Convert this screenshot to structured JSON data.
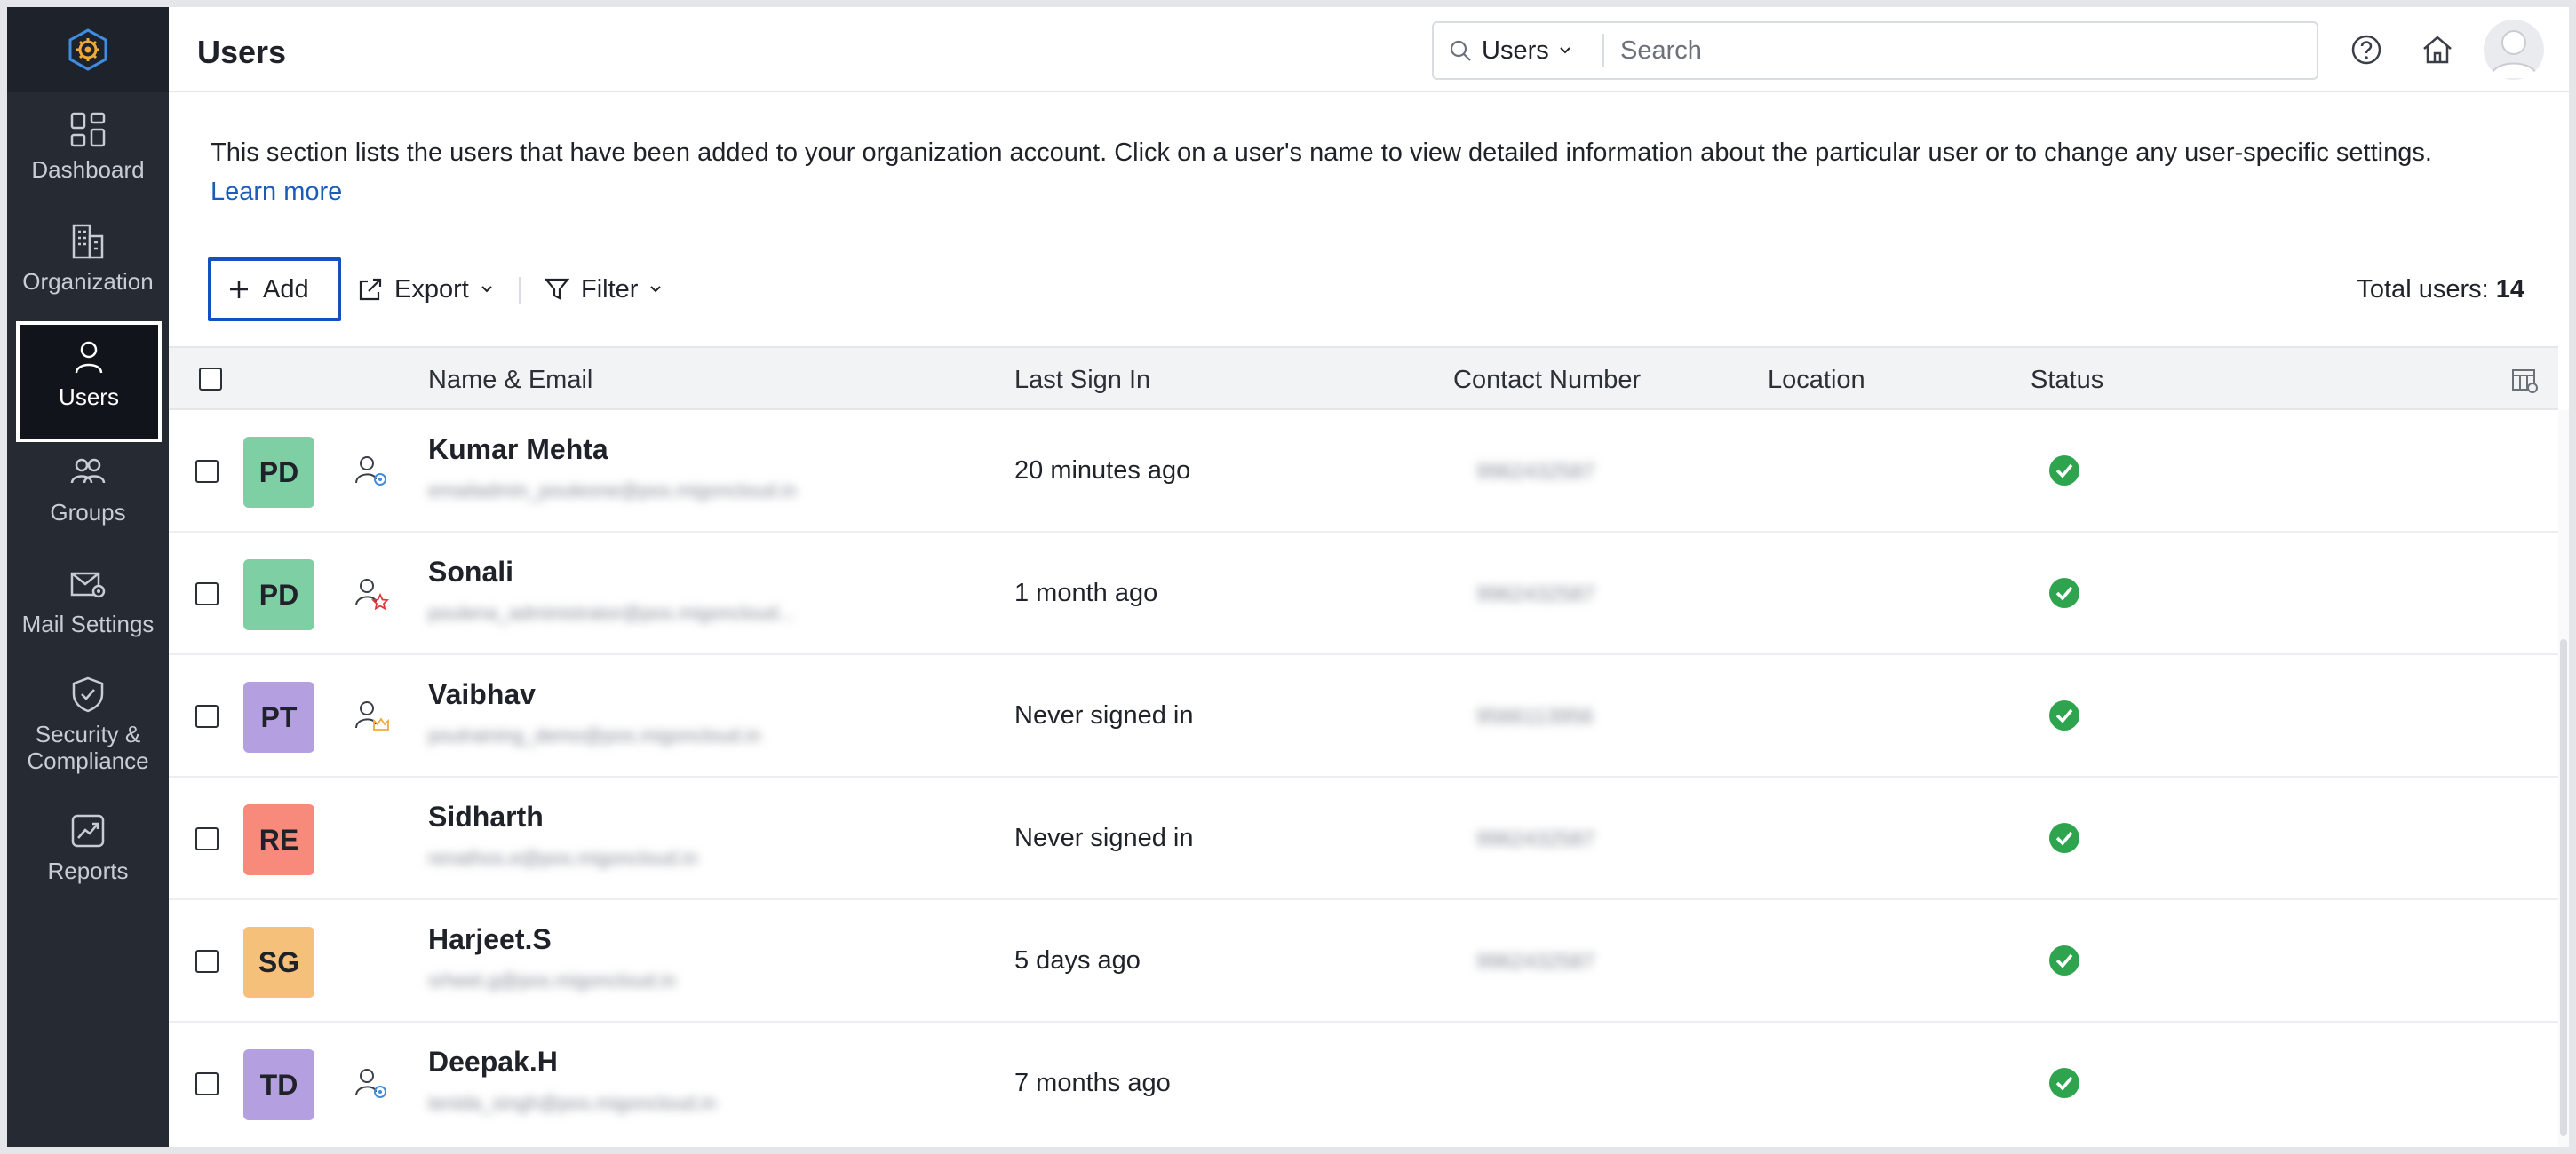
{
  "header": {
    "title": "Users",
    "search_scope": "Users",
    "search_placeholder": "Search"
  },
  "sidebar": {
    "items": [
      {
        "label": "Dashboard",
        "icon": "dashboard-icon"
      },
      {
        "label": "Organization",
        "icon": "organization-icon"
      },
      {
        "label": "Users",
        "icon": "user-icon",
        "active": true
      },
      {
        "label": "Groups",
        "icon": "groups-icon"
      },
      {
        "label": "Mail Settings",
        "icon": "mail-settings-icon"
      },
      {
        "label": "Security & Compliance",
        "icon": "shield-check-icon"
      },
      {
        "label": "Reports",
        "icon": "reports-icon"
      }
    ]
  },
  "intro": {
    "text": "This section lists the users that have been added to your organization account. Click on a user's name to view detailed information about the particular user or to change any user-specific settings.",
    "link": "Learn more"
  },
  "toolbar": {
    "add_label": "Add",
    "export_label": "Export",
    "filter_label": "Filter",
    "total_label": "Total users:",
    "total_count": "14"
  },
  "table": {
    "columns": [
      "Name & Email",
      "Last Sign In",
      "Contact Number",
      "Location",
      "Status"
    ],
    "rows": [
      {
        "initials": "PD",
        "avatar_color": "#7fcfa4",
        "role": "admin",
        "name": "Kumar Mehta",
        "email": "emailadmin_pouleone@pos.migoncloud.in",
        "last_sign_in": "20 minutes ago",
        "contact": "9962432587",
        "location": "",
        "status": "active"
      },
      {
        "initials": "PD",
        "avatar_color": "#7fcfa4",
        "role": "super-admin",
        "name": "Sonali",
        "email": "poulena_administrator@pos.migoncloud...",
        "last_sign_in": "1 month ago",
        "contact": "9962432587",
        "location": "",
        "status": "active"
      },
      {
        "initials": "PT",
        "avatar_color": "#b4a0e0",
        "role": "owner",
        "name": "Vaibhav",
        "email": "poulraining_demo@pos.migoncloud.in",
        "last_sign_in": "Never signed in",
        "contact": "9566113956",
        "location": "",
        "status": "active"
      },
      {
        "initials": "RE",
        "avatar_color": "#f78a7a",
        "role": "none",
        "name": "Sidharth",
        "email": "renathos.e@pos.migoncloud.in",
        "last_sign_in": "Never signed in",
        "contact": "9962432587",
        "location": "",
        "status": "active"
      },
      {
        "initials": "SG",
        "avatar_color": "#f4c07a",
        "role": "none",
        "name": "Harjeet.S",
        "email": "srheet.g@pos.migoncloud.in",
        "last_sign_in": "5 days ago",
        "contact": "9962432587",
        "location": "",
        "status": "active"
      },
      {
        "initials": "TD",
        "avatar_color": "#b4a0e0",
        "role": "admin",
        "name": "Deepak.H",
        "email": "tenida_singh@pos.migoncloud.in",
        "last_sign_in": "7 months ago",
        "contact": "",
        "location": "",
        "status": "active"
      }
    ]
  },
  "colors": {
    "sidebar_bg": "#252a33",
    "accent": "#1450c2",
    "link": "#1a5cb8",
    "status_active": "#2ea44f"
  }
}
